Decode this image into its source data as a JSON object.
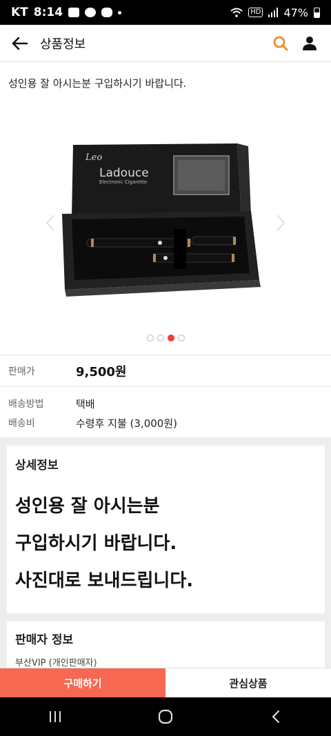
{
  "status_bar": {
    "carrier": "KT",
    "time": "8:14",
    "battery": "47%",
    "network_badge": "HD"
  },
  "header": {
    "title": "상품정보",
    "icons": [
      "back-arrow-icon",
      "search-icon",
      "user-icon"
    ],
    "accent_color": "#f08a24"
  },
  "product": {
    "short_description": "성인용 잘 아시는분 구입하시기 바랍니다.",
    "image_box_brand": "Leo",
    "image_box_title": "Ladouce",
    "image_box_subtitle": "Electronic Cigarette",
    "carousel_total": 4,
    "carousel_active_index": 2
  },
  "info": {
    "price_label": "판매가",
    "price_value": "9,500원",
    "shipping_method_label": "배송방법",
    "shipping_method_value": "택배",
    "shipping_fee_label": "배송비",
    "shipping_fee_value": "수령후 지불 (3,000원)"
  },
  "detail": {
    "title": "상세정보",
    "lines": [
      "성인용 잘 아시는분",
      "구입하시기 바랍니다.",
      "사진대로 보내드립니다."
    ]
  },
  "seller": {
    "title": "판매자 정보",
    "name": "부산VIP (개인판매자)"
  },
  "actions": {
    "buy_label": "구매하기",
    "wishlist_label": "관심상품",
    "buy_color": "#f76852"
  }
}
